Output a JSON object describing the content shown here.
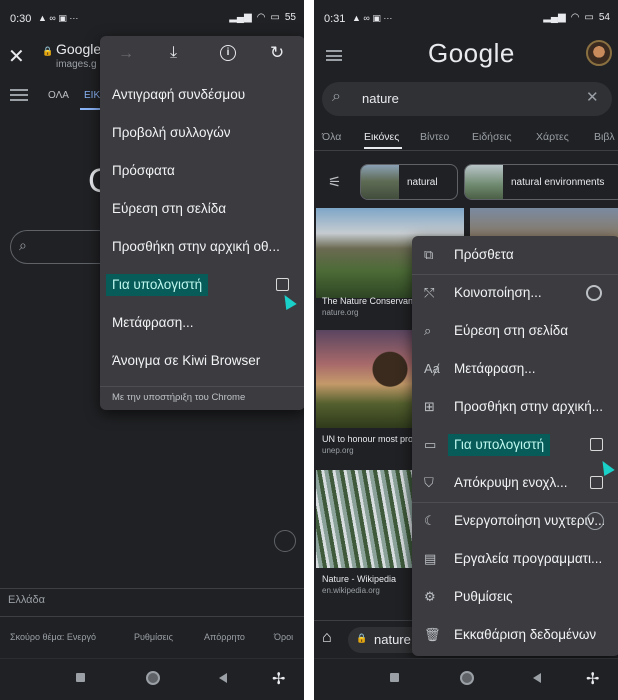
{
  "left": {
    "status": {
      "time": "0:30",
      "battery": "55"
    },
    "header": {
      "site_title": "Google",
      "site_url": "images.g"
    },
    "tabs": {
      "all": "ΟΛΑ",
      "images_partial": "ΕΙΚ"
    },
    "toolbar_icons": [
      "forward-icon",
      "download-icon",
      "info-icon",
      "refresh-icon"
    ],
    "menu_items": [
      "Αντιγραφή συνδέσμου",
      "Προβολή συλλογών",
      "Πρόσφατα",
      "Εύρεση στη σελίδα",
      "Προσθήκη στην αρχική οθ...",
      "Για υπολογιστή",
      "Μετάφραση...",
      "Άνοιγμα σε Kiwi Browser"
    ],
    "menu_footer": "Με την υποστήριξη του Chrome",
    "region": "Ελλάδα",
    "footer_links": [
      "Σκούρο θέμα: Ενεργό",
      "Ρυθμίσεις",
      "Απόρρητο",
      "Όροι"
    ]
  },
  "right": {
    "status": {
      "time": "0:31",
      "battery": "54"
    },
    "logo": "Google",
    "search": {
      "query": "nature"
    },
    "tabs": [
      "Όλα",
      "Εικόνες",
      "Βίντεο",
      "Ειδήσεις",
      "Χάρτες",
      "Βιβλ"
    ],
    "chips": [
      "natural",
      "natural environments"
    ],
    "results": [
      {
        "title": "The Nature Conservancy",
        "source": "nature.org"
      },
      {
        "title": "UN to honour most prom",
        "source": "unep.org"
      },
      {
        "title": "Nature - Wikipedia",
        "source": "en.wikipedia.org"
      }
    ],
    "url_partial": "nature",
    "menu_items": [
      "Πρόσθετα",
      "Κοινοποίηση...",
      "Εύρεση στη σελίδα",
      "Μετάφραση...",
      "Προσθήκη στην αρχική...",
      "Για υπολογιστή",
      "Απόκρυψη ενοχλ...",
      "Ενεργοποίηση νυχτεριν...",
      "Εργαλεία προγραμματι...",
      "Ρυθμίσεις",
      "Εκκαθάριση δεδομένων"
    ]
  },
  "colors": {
    "background": "#202124",
    "menu": "#3c3c40",
    "highlight": "#075c5a",
    "cursor": "#19d1c9"
  }
}
